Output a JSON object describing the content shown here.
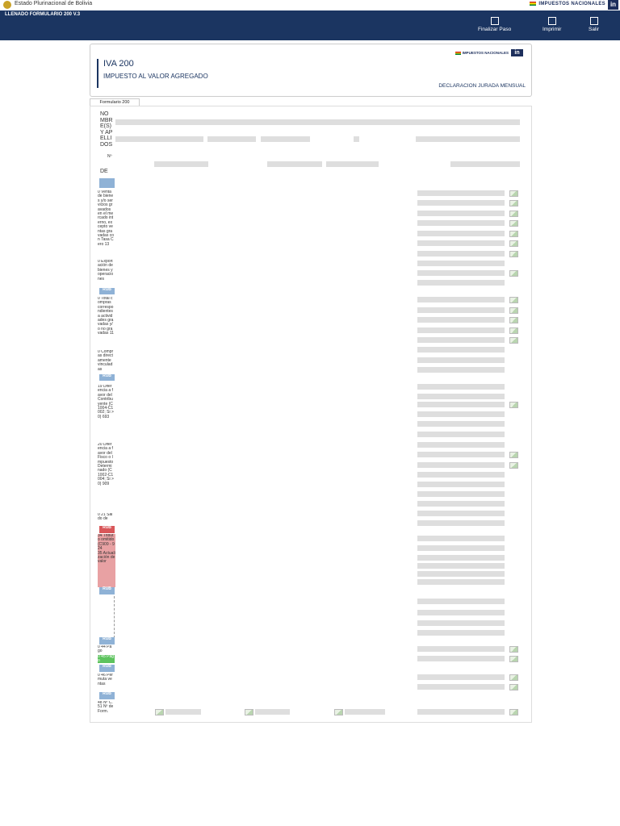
{
  "top": {
    "government": "Estado Plurinacional de Bolivia",
    "brand": "IMPUESTOS NACIONALES",
    "brand_logo_letters": "in"
  },
  "header": {
    "app_title": "LLENADO FORMULARIO 200 V.3",
    "buttons": [
      {
        "label": "Finalizar Paso"
      },
      {
        "label": "Imprimir"
      },
      {
        "label": "Salir"
      }
    ]
  },
  "card": {
    "title": "IVA 200",
    "subtitle": "IMPUESTO AL VALOR AGREGADO",
    "declaration": "DECLARACION JURADA MENSUAL",
    "brand": "IMPUESTOS NACIONALES",
    "brand_logo_letters": "in"
  },
  "tabs": [
    {
      "label": "Formulario 200"
    }
  ],
  "form": {
    "owner_label": "NOMBRE(S) Y APELLIDOS",
    "nit_label": "Nº",
    "period_label": "DE",
    "sections": [
      {
        "text": "0 Venta de bienes y/o servicios gravados en el mercado interno, excepto ventas gravadas con Tasa Cero 13"
      },
      {
        "text": "0 Exportación de bienes y operaciones"
      },
      {
        "text": "0 Total compras correspondientes a actividades gravadas y/o no gravadas 11"
      },
      {
        "text": "0 Compras directamente vinculadas"
      },
      {
        "text": "19 Diferencia a favor del Contribuyente (C1004-C1002; Si >0) 693"
      },
      {
        "text": "20 Diferencia a favor del Fisco o Impuesto Determinado (C1002-C1004; Si >0) 909"
      },
      {
        "text": "0 21 Saldo de"
      },
      {
        "text": "34 Tributo omitido (C909 - 924"
      },
      {
        "text": "35 Actualización de valor"
      },
      {
        "text": "0 44 Pago"
      },
      {
        "text": "0 45 Pago"
      },
      {
        "text": "0 46 Permuta ventas"
      },
      {
        "text": "48 Nº C. 51 Nº de Form."
      }
    ],
    "rubro_label": "RUB",
    "colors": {
      "rubro": "#8fb2d6",
      "red": "#d9575a",
      "pink": "#e8a1a3",
      "green": "#5dc35e"
    }
  }
}
